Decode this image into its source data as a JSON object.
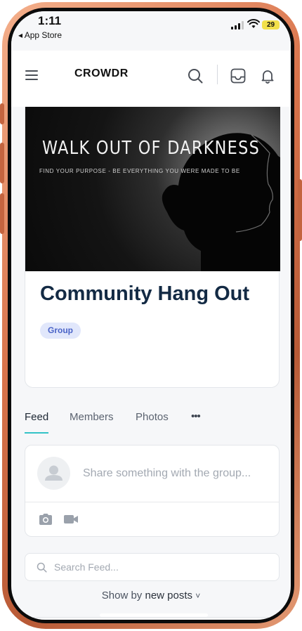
{
  "status_bar": {
    "time": "1:11",
    "back_app": "◂ App Store",
    "battery": "29"
  },
  "header": {
    "logo": "CROWDR",
    "icons": [
      "menu-icon",
      "search-icon",
      "inbox-icon",
      "bell-icon"
    ]
  },
  "group": {
    "cover": {
      "title": "WALK OUT OF DARKNESS",
      "subtitle": "FIND YOUR PURPOSE - BE EVERYTHING YOU WERE MADE TO BE"
    },
    "name": "Community Hang Out",
    "badge": "Group"
  },
  "tabs": [
    {
      "label": "Feed",
      "active": true
    },
    {
      "label": "Members",
      "active": false
    },
    {
      "label": "Photos",
      "active": false
    },
    {
      "label": "•••",
      "active": false
    }
  ],
  "composer": {
    "placeholder": "Share something with the group...",
    "icons": [
      "camera-icon",
      "video-icon"
    ]
  },
  "feed_search": {
    "placeholder": "Search Feed..."
  },
  "sort": {
    "prefix": "Show by",
    "value": "new posts",
    "caret": "˅"
  },
  "colors": {
    "frame": "#d9744c",
    "accent": "#34c3c7",
    "title": "#132a44",
    "badge_bg": "#e1e7fb",
    "badge_text": "#4a63c7"
  }
}
